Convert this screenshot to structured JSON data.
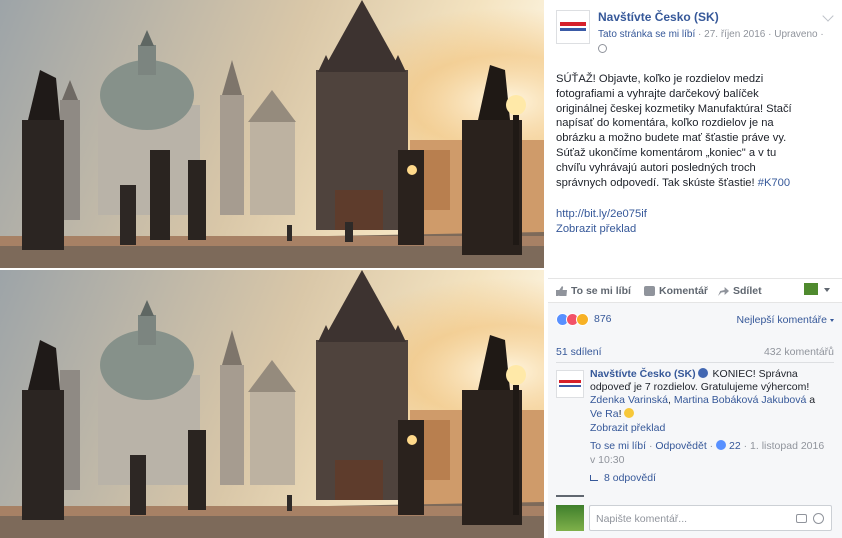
{
  "post": {
    "page_name": "Navštívte Česko (SK)",
    "meta_like": "Tato stránka se mi líbí",
    "meta_sep1": " · ",
    "meta_date": "27. říjen 2016",
    "meta_sep2": " · ",
    "meta_edited": "Upraveno",
    "meta_sep3": " ·",
    "text": "SÚŤAŽ! Objavte, koľko je rozdielov medzi fotografiami a vyhrajte darčekový balíček originálnej českej kozmetiky Manufaktúra! Stačí napísať do komentára, koľko rozdielov je na obrázku a možno budete mať šťastie práve vy. Súťaž ukončíme komentárom „koniec\" a v tu chvíľu vyhrávajú autori posledných troch správnych odpovedí. Tak skúste šťastie!",
    "hashtag": "#K700",
    "link": "http://bit.ly/2e075if",
    "translate": "Zobrazit překlad"
  },
  "actions": {
    "like": "To se mi líbí",
    "comment": "Komentář",
    "share": "Sdílet"
  },
  "stats": {
    "reaction_count": "876",
    "best_comments": "Nejlepší komentáře",
    "shares": "51 sdílení",
    "comments": "432 komentářů"
  },
  "comment": {
    "author": "Navštívte Česko (SK)",
    "text": "KONIEC! Správna odpoveď je 7 rozdielov. Gratulujeme výhercom!",
    "mention1": "Zdenka Varinská",
    "sep1": ", ",
    "mention2": "Martina Bobáková Jakubová",
    "sep2": " a ",
    "mention3": "Ve Ra",
    "excl": "!",
    "translate": "Zobrazit překlad",
    "like": "To se mi líbí",
    "dot1": " · ",
    "reply": "Odpovědět",
    "dot2": " · ",
    "likes": "22",
    "dot3": " · ",
    "date": "1. listopad 2016 v 10:30",
    "replies": "8 odpovědí"
  },
  "composer": {
    "placeholder": "Napište komentář..."
  },
  "colors": {
    "link": "#365899",
    "text": "#1d2129",
    "muted": "#90949c"
  }
}
